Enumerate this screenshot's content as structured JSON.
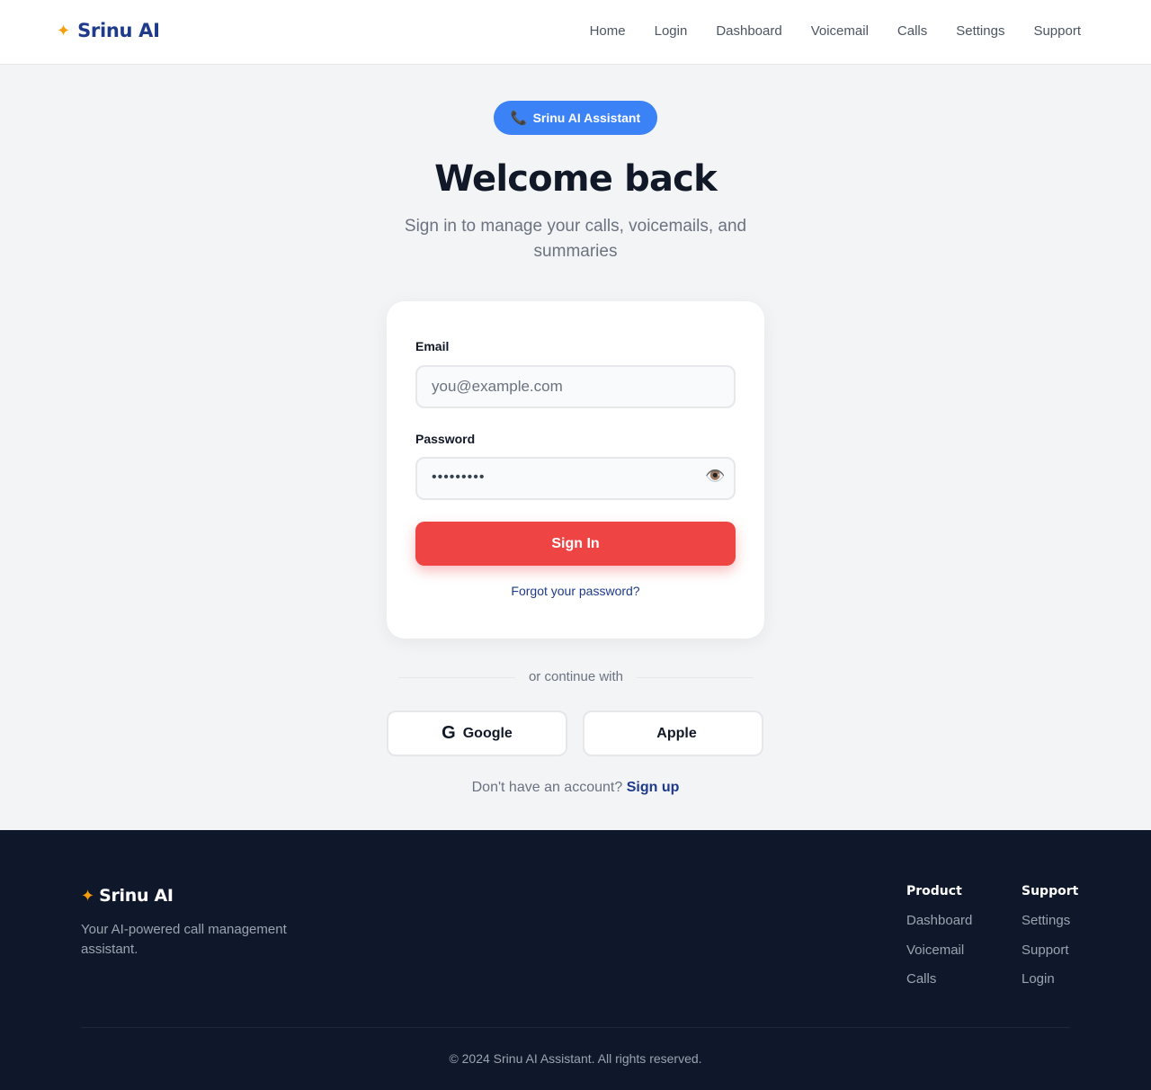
{
  "brand": {
    "name": "Srinu AI",
    "star_icon": "sparkle-icon",
    "star_color": "#f59e0b",
    "name_color": "#1e3a8a"
  },
  "nav": {
    "items": [
      "Home",
      "Login",
      "Dashboard",
      "Voicemail",
      "Calls",
      "Settings",
      "Support"
    ]
  },
  "badge": {
    "icon": "phone-icon",
    "label": "Srinu AI Assistant",
    "color": "#3b82f6"
  },
  "hero": {
    "title": "Welcome back",
    "subtitle": "Sign in to manage your calls, voicemails, and summaries"
  },
  "form": {
    "email_label": "Email",
    "email_placeholder": "you@example.com",
    "password_label": "Password",
    "password_masked": "•••••••••",
    "password_toggle_icon": "eye-icon",
    "submit_label": "Sign In",
    "submit_color": "#ef4444",
    "forgot_label": "Forgot your password?"
  },
  "social": {
    "divider_text": "or continue with",
    "google_label": "Google",
    "google_icon_glyph": "G",
    "apple_label": "Apple",
    "apple_icon_glyph": ""
  },
  "signup": {
    "prompt": "Don't have an account?",
    "link_label": "Sign up"
  },
  "footer": {
    "brand": "Srinu AI",
    "tagline": "Your AI-powered call management assistant.",
    "columns": [
      {
        "title": "Product",
        "links": [
          "Dashboard",
          "Voicemail",
          "Calls"
        ]
      },
      {
        "title": "Support",
        "links": [
          "Settings",
          "Support",
          "Login"
        ]
      }
    ],
    "copyright": "© 2024 Srinu AI Assistant. All rights reserved.",
    "background": "#0f172a"
  }
}
